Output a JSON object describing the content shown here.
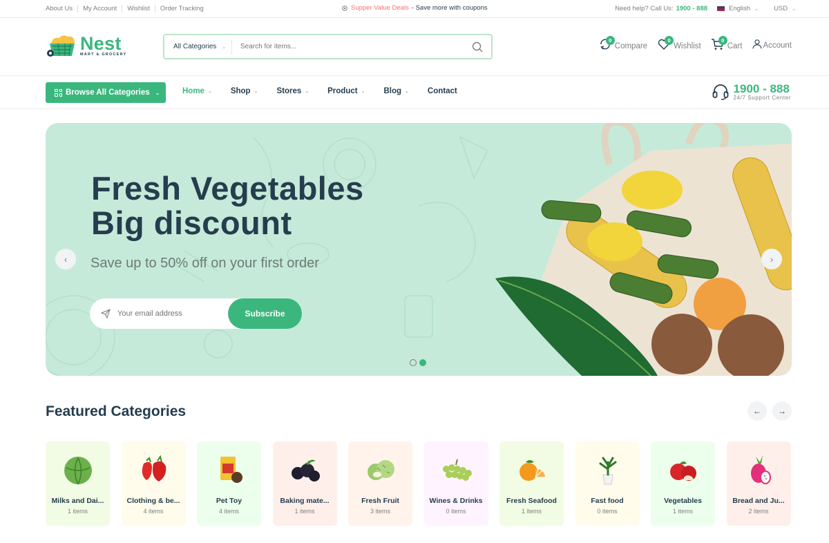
{
  "topbar": {
    "links": [
      "About Us",
      "My Account",
      "Wishlist",
      "Order Tracking"
    ],
    "promo_deal": "Supper Value Deals",
    "promo_save": " - Save more with coupons",
    "help_text": "Need help? Call Us:",
    "help_phone": "1900 - 888",
    "language": "English",
    "currency": "USD"
  },
  "header": {
    "brand_name": "Nest",
    "brand_sub": "MART & GROCERY",
    "search_category": "All Categories",
    "search_placeholder": "Search for items...",
    "actions": [
      {
        "label": "Compare",
        "count": "0"
      },
      {
        "label": "Wishlist",
        "count": "0"
      },
      {
        "label": "Cart",
        "count": "0"
      },
      {
        "label": "Account"
      }
    ]
  },
  "nav": {
    "browse_label": "Browse All Categories",
    "items": [
      "Home",
      "Shop",
      "Stores",
      "Product",
      "Blog",
      "Contact"
    ],
    "support_number": "1900 - 888",
    "support_label": "24/7 Support Center"
  },
  "hero": {
    "title_line1": "Fresh Vegetables",
    "title_line2": "Big discount",
    "subtitle": "Save up to 50% off on your first order",
    "email_placeholder": "Your email address",
    "subscribe_label": "Subscribe",
    "active_slide": 2,
    "total_slides": 2
  },
  "featured": {
    "title": "Featured Categories",
    "categories": [
      {
        "name": "Milks and Dai...",
        "count": "1 items",
        "bg": "#f2fce4"
      },
      {
        "name": "Clothing & be...",
        "count": "4 items",
        "bg": "#fffceb"
      },
      {
        "name": "Pet Toy",
        "count": "4 items",
        "bg": "#ecffec"
      },
      {
        "name": "Baking mate...",
        "count": "1 items",
        "bg": "#feefea"
      },
      {
        "name": "Fresh Fruit",
        "count": "3 items",
        "bg": "#fff3eb"
      },
      {
        "name": "Wines & Drinks",
        "count": "0 items",
        "bg": "#fff3ff"
      },
      {
        "name": "Fresh Seafood",
        "count": "1 items",
        "bg": "#f2fce4"
      },
      {
        "name": "Fast food",
        "count": "0 items",
        "bg": "#fffceb"
      },
      {
        "name": "Vegetables",
        "count": "1 items",
        "bg": "#ecffec"
      },
      {
        "name": "Bread and Ju...",
        "count": "2 items",
        "bg": "#feefea"
      }
    ]
  },
  "colors": {
    "accent": "#3bb77e",
    "heading": "#253d4e",
    "muted": "#7e7e7e",
    "promo": "#fd6e6e"
  }
}
